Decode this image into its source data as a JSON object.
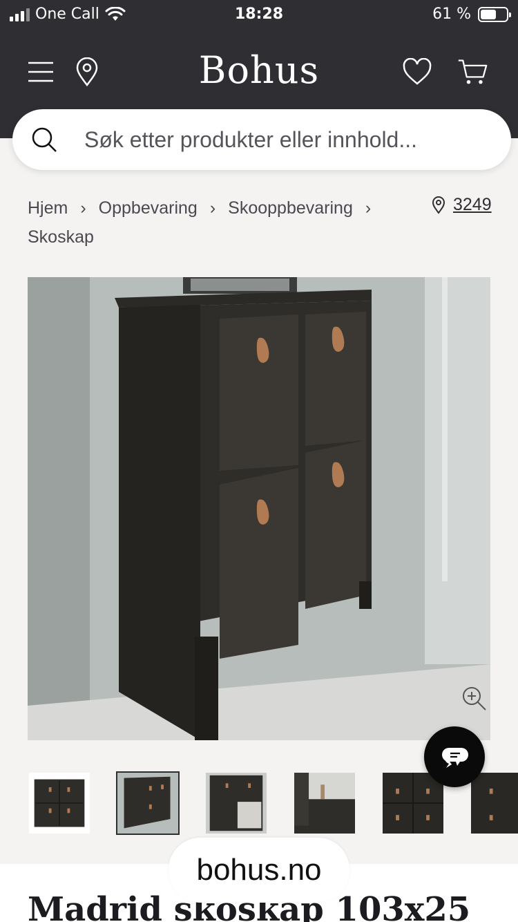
{
  "status_bar": {
    "carrier": "One Call",
    "time": "18:28",
    "battery": "61 %",
    "battery_level": 0.61
  },
  "header": {
    "logo": "Bohus",
    "icons": [
      "menu-icon",
      "location-pin-icon",
      "heart-icon",
      "cart-icon"
    ]
  },
  "search": {
    "placeholder": "Søk etter produkter eller innhold..."
  },
  "breadcrumb": {
    "items": [
      "Hjem",
      "Oppbevaring",
      "Skooppbevaring",
      "Skoskap"
    ],
    "store_number": "3249"
  },
  "gallery": {
    "thumbnail_count": 6,
    "active_index": 1
  },
  "footer": {
    "url": "bohus.no"
  },
  "product": {
    "title": "Madrid skoskap 103x25"
  },
  "colors": {
    "header_bg": "#2f2e33",
    "page_bg": "#f4f3f1",
    "chat_bg": "#0a0a0a"
  }
}
